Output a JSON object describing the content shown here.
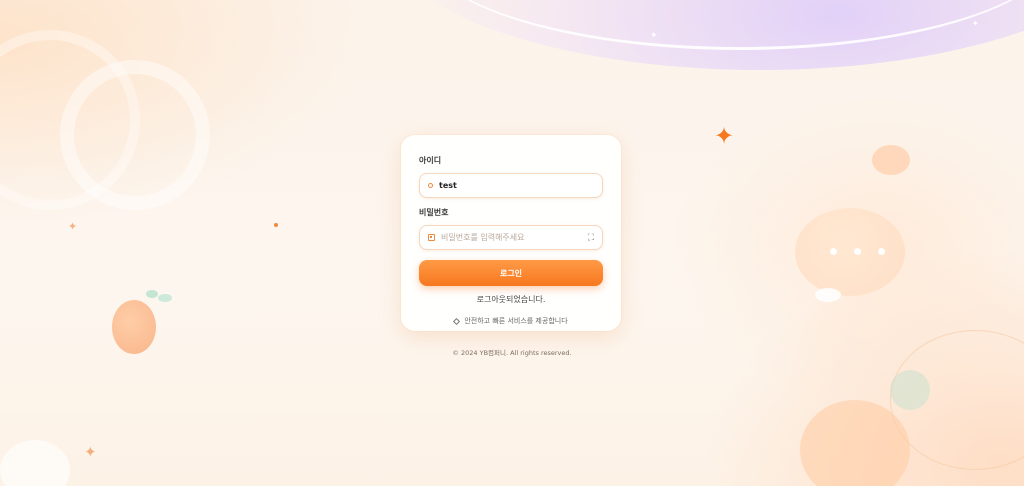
{
  "login": {
    "username_label": "아이디",
    "username_value": "test",
    "password_label": "비밀번호",
    "password_placeholder": "비밀번호를 입력해주세요",
    "login_button": "로그인",
    "status_message": "로그아웃되었습니다.",
    "slogan": "안전하고 빠른 서비스를 제공합니다"
  },
  "footer": {
    "copyright": "© 2024 YB컴퍼니. All rights reserved."
  },
  "colors": {
    "accent": "#f7781f",
    "background": "#fdf5ec"
  },
  "icons": {
    "username": "user-icon",
    "password": "lock-icon",
    "toggle": "eye-icon",
    "slogan": "diamond-icon"
  }
}
